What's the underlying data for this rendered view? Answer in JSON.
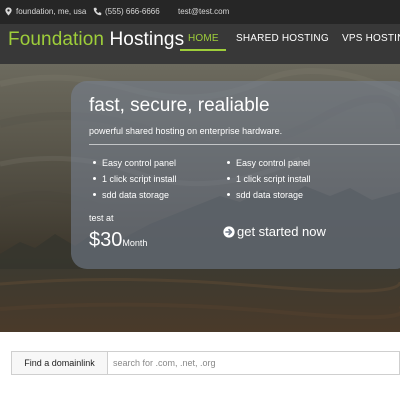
{
  "topbar": {
    "location": "foundation, me, usa",
    "phone": "(555) 666-6666",
    "email": "test@test.com"
  },
  "header": {
    "logo_part1": "Foundation",
    "logo_part2": "Hostings",
    "nav": [
      {
        "label": "HOME",
        "active": true
      },
      {
        "label": "SHARED HOSTING",
        "active": false
      },
      {
        "label": "VPS HOSTIN",
        "active": false
      }
    ]
  },
  "hero": {
    "title": "fast, secure, realiable",
    "subtitle": "powerful shared hosting on enterprise hardware.",
    "features_left": [
      "Easy control panel",
      "1 click script install",
      "sdd data storage"
    ],
    "features_right": [
      "Easy control panel",
      "1 click script install",
      "sdd data storage"
    ],
    "from_label": "test at",
    "price": "$30",
    "price_period": "Month",
    "cta": "get started now"
  },
  "domain_search": {
    "label_prefix": "Find a domain",
    "label_link": "link",
    "placeholder": "search for .com, .net, .org"
  },
  "colors": {
    "accent": "#9ece3a",
    "header_bg": "#383838",
    "topbar_bg": "#262626"
  },
  "icons": [
    "map-marker-icon",
    "phone-icon",
    "arrow-circle-right-icon"
  ]
}
